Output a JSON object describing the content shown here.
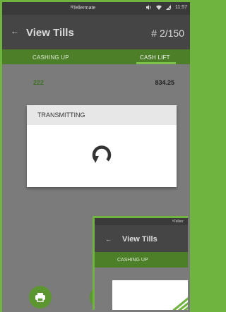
{
  "statusbar": {
    "app_name": "ᴺTellermate",
    "time": "11:57"
  },
  "appbar": {
    "back_icon": "←",
    "title": "View Tills",
    "count": "# 2/150"
  },
  "tabs": [
    {
      "label": "CASHING UP"
    },
    {
      "label": "CASH LIFT"
    }
  ],
  "row": {
    "id": "222",
    "value": "834.25"
  },
  "dialog": {
    "title": "TRANSMITTING",
    "spinner_icon": "refresh-icon"
  },
  "nested": {
    "app_name": "ᴺTellerr",
    "back_icon": "←",
    "title": "View Tills",
    "tab_label": "CASHING UP"
  },
  "colors": {
    "accent": "#6fb43f",
    "tab_bg": "#4d7f29",
    "appbar_bg": "#454545",
    "fab": "#5c9630"
  }
}
